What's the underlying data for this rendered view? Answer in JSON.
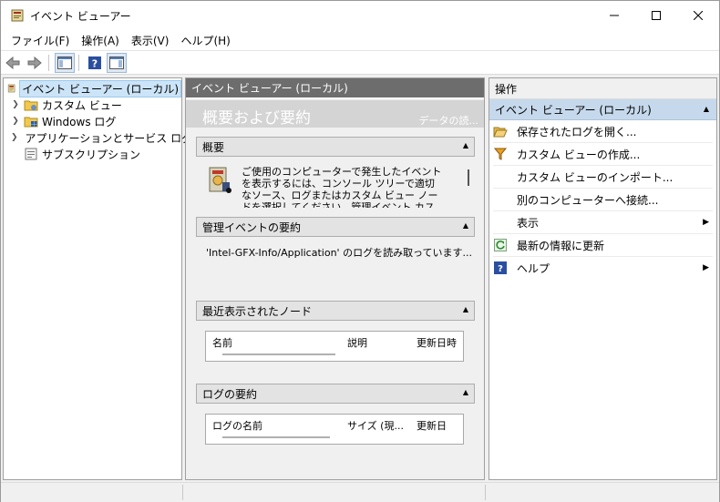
{
  "window": {
    "title": "イベント ビューアー"
  },
  "menu": [
    "ファイル(F)",
    "操作(A)",
    "表示(V)",
    "ヘルプ(H)"
  ],
  "tree": {
    "items": [
      {
        "label": "イベント ビューアー (ローカル)",
        "icon": "event-viewer-icon",
        "selected": true
      },
      {
        "label": "カスタム ビュー",
        "icon": "folder-icon"
      },
      {
        "label": "Windows ログ",
        "icon": "windows-logs-icon"
      },
      {
        "label": "アプリケーションとサービス ログ",
        "icon": "folder-icon"
      },
      {
        "label": "サブスクリプション",
        "icon": "subscription-icon"
      }
    ]
  },
  "center": {
    "header": "イベント ビューアー (ローカル)",
    "overview_title": "概要および要約",
    "overview_sub": "データの読...",
    "sections": {
      "overview": {
        "title": "概要",
        "text": "ご使用のコンピューターで発生したイベントを表示するには、コンソール ツリーで適切なソース、ログまたはカスタム ビュー ノードを選択してください。管理イベント カスタム ビューには、ソースに"
      },
      "admin": {
        "title": "管理イベントの要約",
        "text": "'Intel-GFX-Info/Application' のログを読み取っています..."
      },
      "recent": {
        "title": "最近表示されたノード",
        "columns": [
          "名前",
          "説明",
          "更新日時"
        ]
      },
      "logsummary": {
        "title": "ログの要約",
        "columns": [
          "ログの名前",
          "サイズ (現...",
          "更新日"
        ]
      }
    }
  },
  "actions": {
    "header": "操作",
    "group": "イベント ビューアー (ローカル)",
    "items": [
      {
        "label": "保存されたログを開く...",
        "icon": "open-folder-icon"
      },
      {
        "label": "カスタム ビューの作成...",
        "icon": "filter-icon"
      },
      {
        "label": "カスタム ビューのインポート...",
        "icon": ""
      },
      {
        "label": "別のコンピューターへ接続...",
        "icon": ""
      },
      {
        "label": "表示",
        "icon": "",
        "submenu": true
      },
      {
        "label": "最新の情報に更新",
        "icon": "refresh-icon"
      },
      {
        "label": "ヘルプ",
        "icon": "help-icon",
        "submenu": true
      }
    ]
  },
  "colors": {
    "center_header": "#6d6d6d",
    "action_group": "#c6d9ec",
    "selection": "#cce4f7"
  }
}
